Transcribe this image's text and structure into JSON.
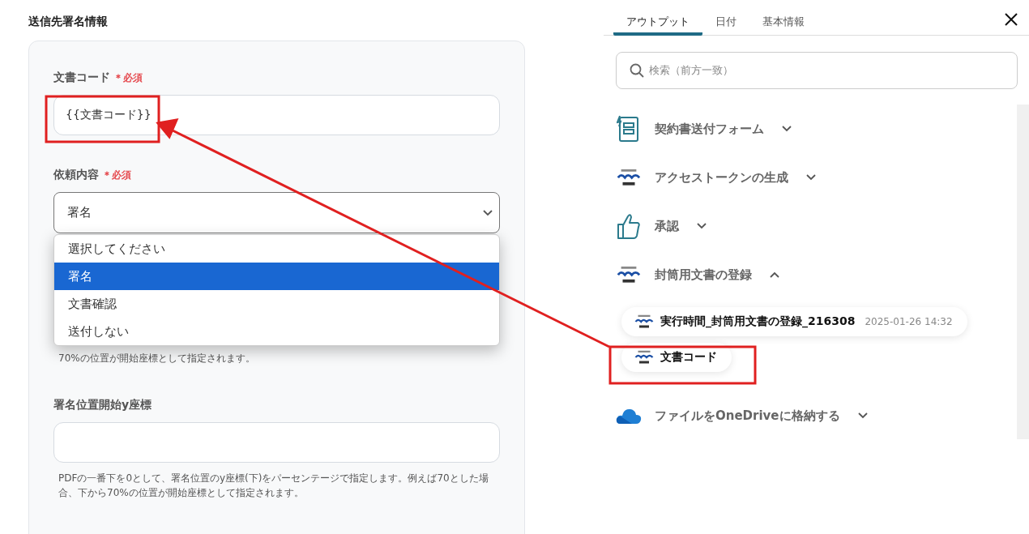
{
  "form": {
    "section_title": "送信先署名情報",
    "fields": [
      {
        "kind": "text",
        "label": "文書コード",
        "required_badge": "＊必須",
        "value": "{{文書コード}}"
      },
      {
        "kind": "select",
        "label": "依頼内容",
        "required_badge": "＊必須",
        "value": "署名",
        "open": true,
        "options": [
          {
            "label": "選択してください",
            "selected": false
          },
          {
            "label": "署名",
            "selected": true
          },
          {
            "label": "文書確認",
            "selected": false
          },
          {
            "label": "送付しない",
            "selected": false
          }
        ]
      },
      {
        "kind": "covered",
        "help": "70%の位置が開始座標として指定されます。"
      },
      {
        "kind": "text",
        "label": "署名位置開始y座標",
        "help": "PDFの一番下を0として、署名位置のy座標(下)をパーセンテージで指定します。例えば70とした場合、下から70%の位置が開始座標として指定されます。"
      }
    ]
  },
  "output_panel": {
    "tabs": [
      {
        "label": "アウトプット",
        "selected": true
      },
      {
        "label": "日付",
        "selected": false
      },
      {
        "label": "基本情報",
        "selected": false
      }
    ],
    "search": {
      "placeholder": "検索（前方一致）"
    },
    "groups": [
      {
        "kind": "form",
        "title": "契約書送付フォーム",
        "expanded": false
      },
      {
        "kind": "gmo",
        "title": "アクセストークンの生成",
        "expanded": false
      },
      {
        "kind": "thumb",
        "title": "承認",
        "expanded": false
      },
      {
        "kind": "gmo",
        "title": "封筒用文書の登録",
        "expanded": true,
        "children": [
          {
            "label": "実行時間_封筒用文書の登録_216308",
            "time": "2025-01-26 14:32"
          },
          {
            "label": "文書コード"
          }
        ]
      },
      {
        "kind": "cloud",
        "title": "ファイルをOneDriveに格納する",
        "expanded": false
      }
    ]
  }
}
